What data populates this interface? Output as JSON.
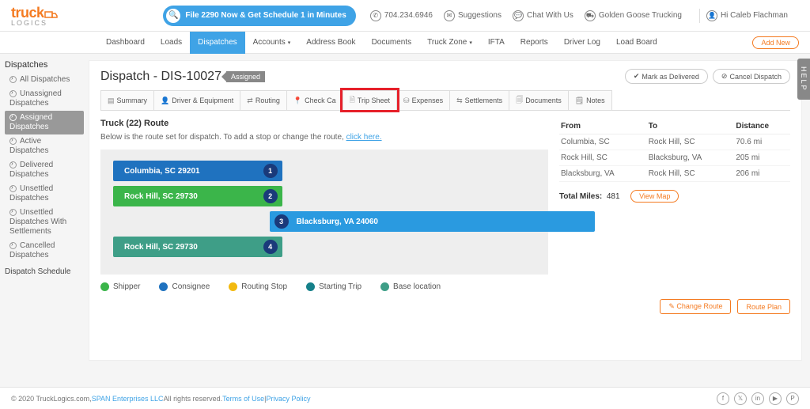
{
  "brand": "truck",
  "brand_sub": "LOGICS",
  "cta": "File 2290 Now & Get Schedule 1 in Minutes",
  "phone": "704.234.6946",
  "top_links": {
    "suggestions": "Suggestions",
    "chat": "Chat With Us",
    "company": "Golden Goose Trucking",
    "greeting": "Hi Caleb Flachman"
  },
  "nav": [
    "Dashboard",
    "Loads",
    "Dispatches",
    "Accounts ",
    "Address Book",
    "Documents",
    "Truck Zone ",
    "IFTA",
    "Reports",
    "Driver Log",
    "Load Board"
  ],
  "add_new": "Add New",
  "sidebar_title": "Dispatches",
  "sidebar_items": [
    "All Dispatches",
    "Unassigned Dispatches",
    "Assigned Dispatches",
    "Active Dispatches",
    "Delivered Dispatches",
    "Unsettled Dispatches",
    "Unsettled Dispatches With Settlements",
    "Cancelled Dispatches"
  ],
  "sidebar_schedule": "Dispatch Schedule",
  "page_title": "Dispatch - DIS-10027",
  "status_tag": "Assigned",
  "btn_delivered": "Mark as Delivered",
  "btn_cancel": "Cancel Dispatch",
  "tabs": [
    "Summary",
    "Driver & Equipment",
    "Routing",
    "Check Ca",
    "Trip Sheet",
    "Expenses",
    "Settlements",
    "Documents",
    "Notes"
  ],
  "route_title": "Truck (22) Route",
  "route_desc": "Below is the route set for dispatch. To add a stop or change the route, ",
  "route_link": "click here.",
  "stops": [
    {
      "n": "1",
      "label": "Columbia, SC 29201"
    },
    {
      "n": "2",
      "label": "Rock Hill, SC 29730"
    },
    {
      "n": "3",
      "label": "Blacksburg, VA 24060"
    },
    {
      "n": "4",
      "label": "Rock Hill, SC 29730"
    }
  ],
  "legend": [
    "Shipper",
    "Consignee",
    "Routing Stop",
    "Starting Trip",
    "Base location"
  ],
  "legend_colors": [
    "#3bb54a",
    "#1f72bf",
    "#f2b90f",
    "#15808a",
    "#3e9e87"
  ],
  "table": {
    "head": [
      "From",
      "To",
      "Distance"
    ],
    "rows": [
      [
        "Columbia, SC",
        "Rock Hill, SC",
        "70.6 mi"
      ],
      [
        "Rock Hill, SC",
        "Blacksburg, VA",
        "205 mi"
      ],
      [
        "Blacksburg, VA",
        "Rock Hill, SC",
        "206 mi"
      ]
    ]
  },
  "total_label": "Total Miles:",
  "total_value": "481",
  "view_map": "View Map",
  "change_route": "Change Route",
  "route_plan": "Route Plan",
  "help": "HELP",
  "footer": {
    "copy": "© 2020 TruckLogics.com, ",
    "span": "SPAN Enterprises LLC",
    "rights": " All rights reserved. ",
    "terms": "Terms of Use",
    "sep": " | ",
    "privacy": "Privacy Policy"
  }
}
